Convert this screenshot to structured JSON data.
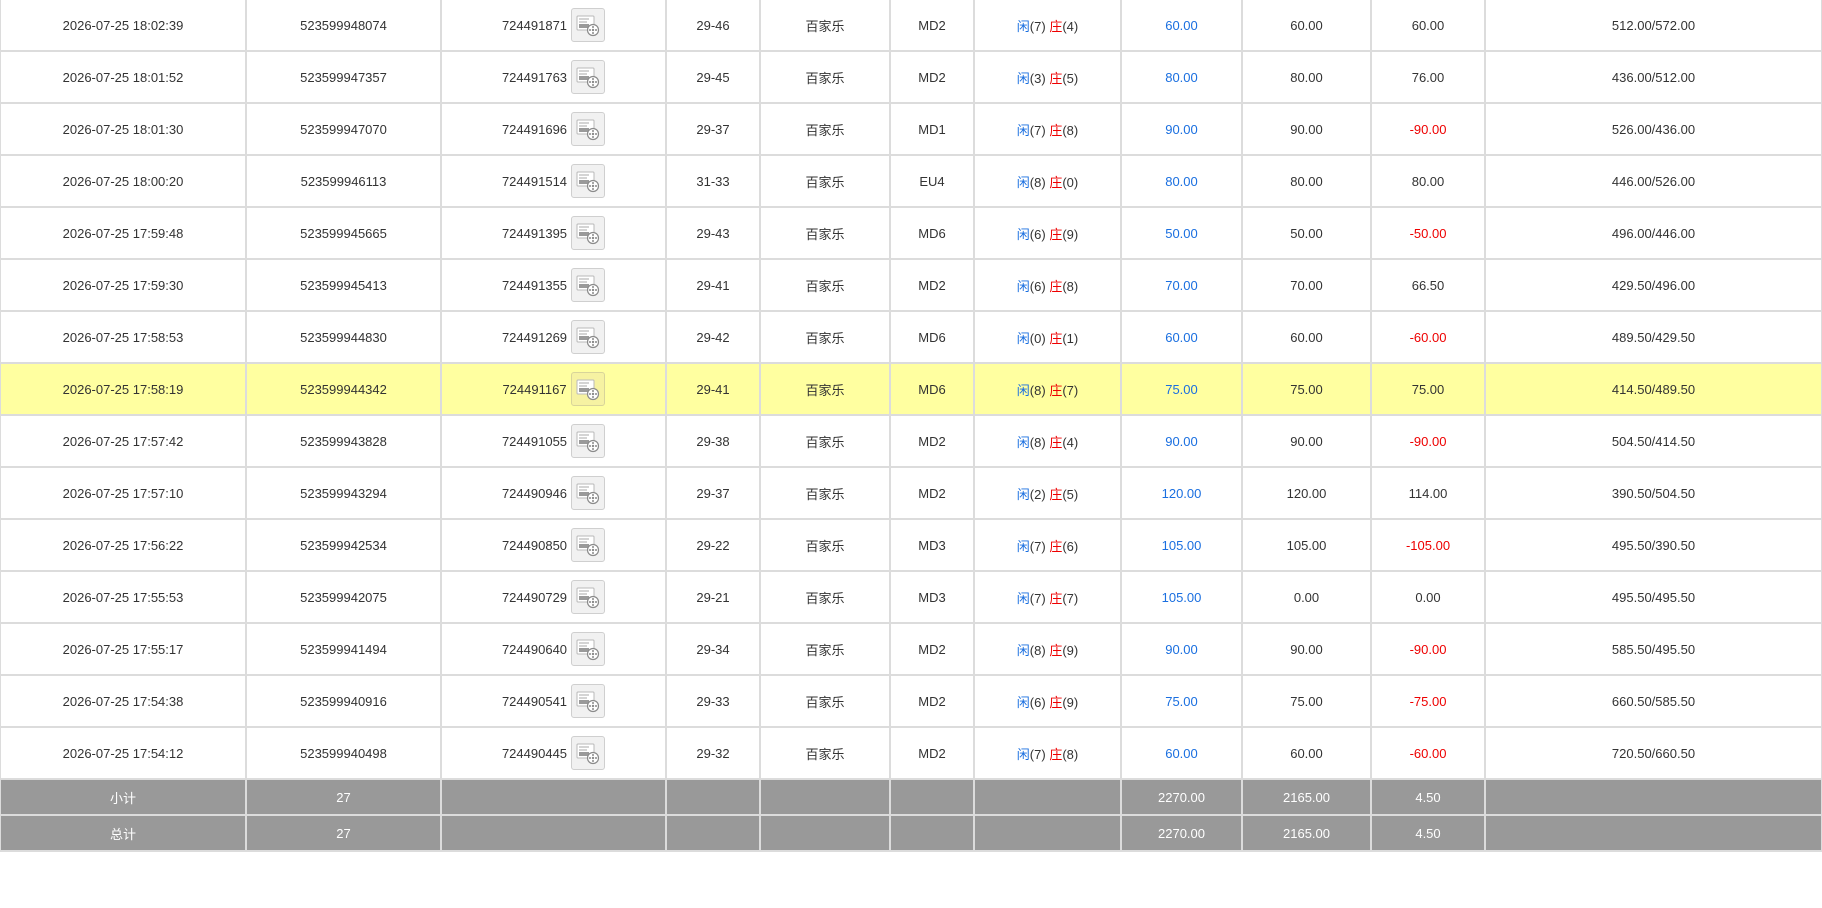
{
  "colors": {
    "player": "#1a6fe0",
    "banker": "#ee0000",
    "highlight": "#ffffa0",
    "summary_bg": "#999999"
  },
  "icons": {
    "record": "video-record-icon"
  },
  "rows": [
    {
      "time": "2026-07-25 18:02:39",
      "bet_no": "523599948074",
      "round_no": "724491871",
      "shoe": "29-46",
      "game": "百家乐",
      "table": "MD2",
      "p_label": "闲",
      "p_pts": "(7)",
      "b_label": "庄",
      "b_pts": "(4)",
      "bet": "60.00",
      "valid": "60.00",
      "win": "60.00",
      "win_neg": false,
      "balance": "512.00/572.00"
    },
    {
      "time": "2026-07-25 18:01:52",
      "bet_no": "523599947357",
      "round_no": "724491763",
      "shoe": "29-45",
      "game": "百家乐",
      "table": "MD2",
      "p_label": "闲",
      "p_pts": "(3)",
      "b_label": "庄",
      "b_pts": "(5)",
      "bet": "80.00",
      "valid": "80.00",
      "win": "76.00",
      "win_neg": false,
      "balance": "436.00/512.00"
    },
    {
      "time": "2026-07-25 18:01:30",
      "bet_no": "523599947070",
      "round_no": "724491696",
      "shoe": "29-37",
      "game": "百家乐",
      "table": "MD1",
      "p_label": "闲",
      "p_pts": "(7)",
      "b_label": "庄",
      "b_pts": "(8)",
      "bet": "90.00",
      "valid": "90.00",
      "win": "-90.00",
      "win_neg": true,
      "balance": "526.00/436.00"
    },
    {
      "time": "2026-07-25 18:00:20",
      "bet_no": "523599946113",
      "round_no": "724491514",
      "shoe": "31-33",
      "game": "百家乐",
      "table": "EU4",
      "p_label": "闲",
      "p_pts": "(8)",
      "b_label": "庄",
      "b_pts": "(0)",
      "bet": "80.00",
      "valid": "80.00",
      "win": "80.00",
      "win_neg": false,
      "balance": "446.00/526.00"
    },
    {
      "time": "2026-07-25 17:59:48",
      "bet_no": "523599945665",
      "round_no": "724491395",
      "shoe": "29-43",
      "game": "百家乐",
      "table": "MD6",
      "p_label": "闲",
      "p_pts": "(6)",
      "b_label": "庄",
      "b_pts": "(9)",
      "bet": "50.00",
      "valid": "50.00",
      "win": "-50.00",
      "win_neg": true,
      "balance": "496.00/446.00"
    },
    {
      "time": "2026-07-25 17:59:30",
      "bet_no": "523599945413",
      "round_no": "724491355",
      "shoe": "29-41",
      "game": "百家乐",
      "table": "MD2",
      "p_label": "闲",
      "p_pts": "(6)",
      "b_label": "庄",
      "b_pts": "(8)",
      "bet": "70.00",
      "valid": "70.00",
      "win": "66.50",
      "win_neg": false,
      "balance": "429.50/496.00"
    },
    {
      "time": "2026-07-25 17:58:53",
      "bet_no": "523599944830",
      "round_no": "724491269",
      "shoe": "29-42",
      "game": "百家乐",
      "table": "MD6",
      "p_label": "闲",
      "p_pts": "(0)",
      "b_label": "庄",
      "b_pts": "(1)",
      "bet": "60.00",
      "valid": "60.00",
      "win": "-60.00",
      "win_neg": true,
      "balance": "489.50/429.50"
    },
    {
      "time": "2026-07-25 17:58:19",
      "bet_no": "523599944342",
      "round_no": "724491167",
      "shoe": "29-41",
      "game": "百家乐",
      "table": "MD6",
      "p_label": "闲",
      "p_pts": "(8)",
      "b_label": "庄",
      "b_pts": "(7)",
      "bet": "75.00",
      "valid": "75.00",
      "win": "75.00",
      "win_neg": false,
      "balance": "414.50/489.50",
      "highlight": true
    },
    {
      "time": "2026-07-25 17:57:42",
      "bet_no": "523599943828",
      "round_no": "724491055",
      "shoe": "29-38",
      "game": "百家乐",
      "table": "MD2",
      "p_label": "闲",
      "p_pts": "(8)",
      "b_label": "庄",
      "b_pts": "(4)",
      "bet": "90.00",
      "valid": "90.00",
      "win": "-90.00",
      "win_neg": true,
      "balance": "504.50/414.50"
    },
    {
      "time": "2026-07-25 17:57:10",
      "bet_no": "523599943294",
      "round_no": "724490946",
      "shoe": "29-37",
      "game": "百家乐",
      "table": "MD2",
      "p_label": "闲",
      "p_pts": "(2)",
      "b_label": "庄",
      "b_pts": "(5)",
      "bet": "120.00",
      "valid": "120.00",
      "win": "114.00",
      "win_neg": false,
      "balance": "390.50/504.50"
    },
    {
      "time": "2026-07-25 17:56:22",
      "bet_no": "523599942534",
      "round_no": "724490850",
      "shoe": "29-22",
      "game": "百家乐",
      "table": "MD3",
      "p_label": "闲",
      "p_pts": "(7)",
      "b_label": "庄",
      "b_pts": "(6)",
      "bet": "105.00",
      "valid": "105.00",
      "win": "-105.00",
      "win_neg": true,
      "balance": "495.50/390.50"
    },
    {
      "time": "2026-07-25 17:55:53",
      "bet_no": "523599942075",
      "round_no": "724490729",
      "shoe": "29-21",
      "game": "百家乐",
      "table": "MD3",
      "p_label": "闲",
      "p_pts": "(7)",
      "b_label": "庄",
      "b_pts": "(7)",
      "bet": "105.00",
      "valid": "0.00",
      "win": "0.00",
      "win_neg": false,
      "balance": "495.50/495.50"
    },
    {
      "time": "2026-07-25 17:55:17",
      "bet_no": "523599941494",
      "round_no": "724490640",
      "shoe": "29-34",
      "game": "百家乐",
      "table": "MD2",
      "p_label": "闲",
      "p_pts": "(8)",
      "b_label": "庄",
      "b_pts": "(9)",
      "bet": "90.00",
      "valid": "90.00",
      "win": "-90.00",
      "win_neg": true,
      "balance": "585.50/495.50"
    },
    {
      "time": "2026-07-25 17:54:38",
      "bet_no": "523599940916",
      "round_no": "724490541",
      "shoe": "29-33",
      "game": "百家乐",
      "table": "MD2",
      "p_label": "闲",
      "p_pts": "(6)",
      "b_label": "庄",
      "b_pts": "(9)",
      "bet": "75.00",
      "valid": "75.00",
      "win": "-75.00",
      "win_neg": true,
      "balance": "660.50/585.50"
    },
    {
      "time": "2026-07-25 17:54:12",
      "bet_no": "523599940498",
      "round_no": "724490445",
      "shoe": "29-32",
      "game": "百家乐",
      "table": "MD2",
      "p_label": "闲",
      "p_pts": "(7)",
      "b_label": "庄",
      "b_pts": "(8)",
      "bet": "60.00",
      "valid": "60.00",
      "win": "-60.00",
      "win_neg": true,
      "balance": "720.50/660.50"
    }
  ],
  "subtotal": {
    "label": "小计",
    "count": "27",
    "bet": "2270.00",
    "valid": "2165.00",
    "win": "4.50"
  },
  "total": {
    "label": "总计",
    "count": "27",
    "bet": "2270.00",
    "valid": "2165.00",
    "win": "4.50"
  }
}
